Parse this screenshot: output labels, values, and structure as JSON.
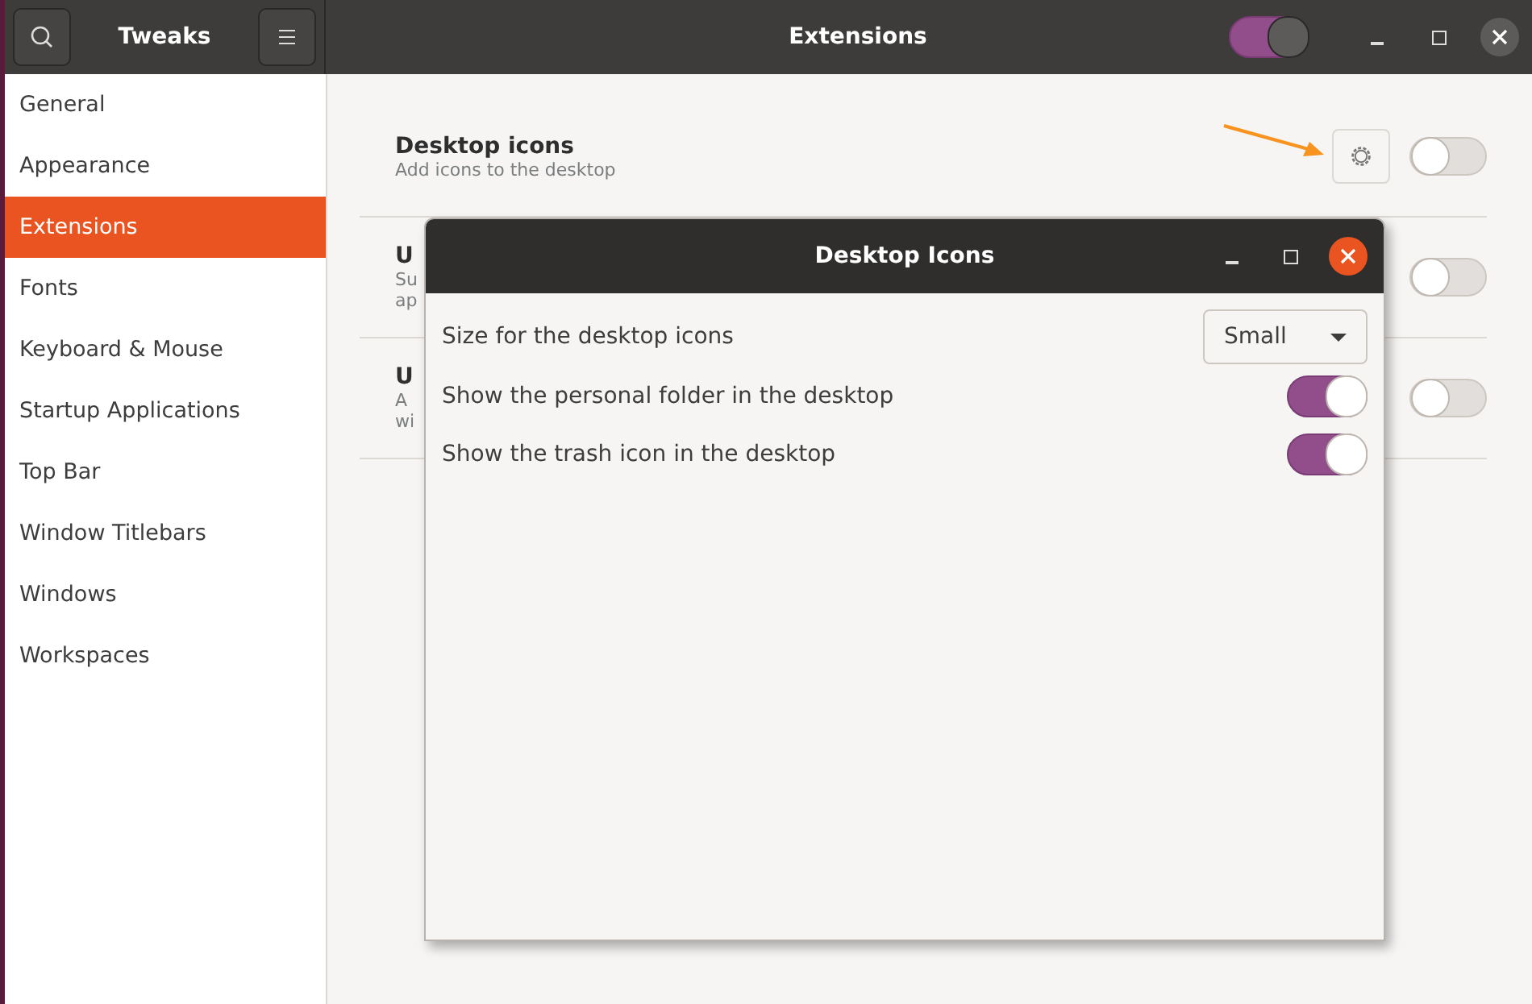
{
  "window": {
    "title": "Extensions",
    "app_title": "Tweaks",
    "master_switch": {
      "on": true
    }
  },
  "sidebar": {
    "items": [
      {
        "label": "General",
        "selected": false
      },
      {
        "label": "Appearance",
        "selected": false
      },
      {
        "label": "Extensions",
        "selected": true
      },
      {
        "label": "Fonts",
        "selected": false
      },
      {
        "label": "Keyboard & Mouse",
        "selected": false
      },
      {
        "label": "Startup Applications",
        "selected": false
      },
      {
        "label": "Top Bar",
        "selected": false
      },
      {
        "label": "Window Titlebars",
        "selected": false
      },
      {
        "label": "Windows",
        "selected": false
      },
      {
        "label": "Workspaces",
        "selected": false
      }
    ]
  },
  "extensions": [
    {
      "title": "Desktop icons",
      "description": [
        "Add icons to the desktop"
      ],
      "has_settings": true,
      "on": false
    },
    {
      "title": "U",
      "description": [
        "Su",
        "ap"
      ],
      "has_settings": false,
      "on": false
    },
    {
      "title": "U",
      "description": [
        "A",
        "wi"
      ],
      "has_settings": false,
      "on": false
    }
  ],
  "dialog": {
    "title": "Desktop Icons",
    "settings": [
      {
        "kind": "dropdown",
        "label": "Size for the desktop icons",
        "value": "Small"
      },
      {
        "kind": "switch",
        "label": "Show the personal folder in the desktop",
        "on": true
      },
      {
        "kind": "switch",
        "label": "Show the trash icon in the desktop",
        "on": true
      }
    ]
  }
}
